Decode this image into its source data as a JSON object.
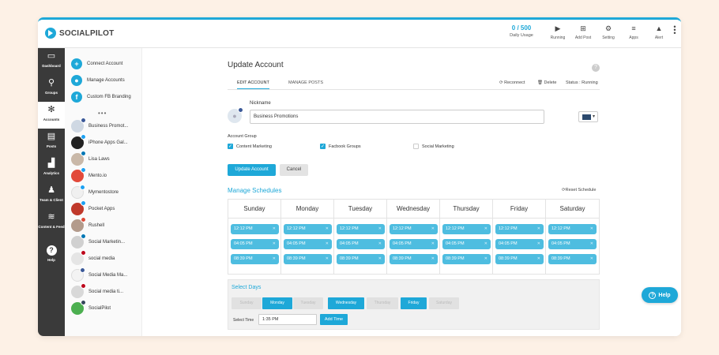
{
  "brand": {
    "name": "SOCIALPILOT",
    "accent": "#1ea8d8"
  },
  "topnav": {
    "usage_value": "0 / 500",
    "usage_label": "Daily Usage",
    "items": [
      {
        "label": "Running",
        "icon": "play-circle-icon"
      },
      {
        "label": "Add Post",
        "icon": "plus-square-icon"
      },
      {
        "label": "Setting",
        "icon": "gear-icon"
      },
      {
        "label": "Apps",
        "icon": "menu-icon"
      },
      {
        "label": "Alert",
        "icon": "bell-icon"
      }
    ]
  },
  "leftnav": [
    {
      "label": "Dashboard",
      "icon": "monitor-icon"
    },
    {
      "label": "Groups",
      "icon": "hierarchy-icon"
    },
    {
      "label": "Accounts",
      "icon": "network-icon"
    },
    {
      "label": "Posts",
      "icon": "chat-icon"
    },
    {
      "label": "Analytics",
      "icon": "bar-chart-icon"
    },
    {
      "label": "Team & Client",
      "icon": "people-icon"
    },
    {
      "label": "Content & Feed",
      "icon": "layers-icon"
    },
    {
      "label": "Help",
      "icon": "question-icon"
    }
  ],
  "account_panel": {
    "actions": [
      {
        "label": "Connect Account",
        "icon": "plus-icon"
      },
      {
        "label": "Manage Accounts",
        "icon": "user-icon"
      },
      {
        "label": "Custom FB Branding",
        "icon": "facebook-icon"
      }
    ],
    "more": "•••",
    "accounts": [
      {
        "name": "Business Promot...",
        "network": "facebook"
      },
      {
        "name": "iPhone Apps Gal...",
        "network": "twitter"
      },
      {
        "name": "Lisa Laws",
        "network": "linkedin"
      },
      {
        "name": "Mento.io",
        "network": "twitter"
      },
      {
        "name": "Mymentostore",
        "network": "twitter"
      },
      {
        "name": "Pocket Apps",
        "network": "twitter"
      },
      {
        "name": "Rushell",
        "network": "google"
      },
      {
        "name": "Social Marketin...",
        "network": "linkedin"
      },
      {
        "name": "social media",
        "network": "pinterest"
      },
      {
        "name": "Social Media Ma...",
        "network": "facebook"
      },
      {
        "name": "Social media ti...",
        "network": "pinterest"
      },
      {
        "name": "SocialPilot",
        "network": "tumblr"
      }
    ]
  },
  "update_account": {
    "title": "Update Account",
    "tabs": [
      "EDIT ACCOUNT",
      "MANAGE POSTS"
    ],
    "tab_actions": {
      "reconnect": "Reconnect",
      "delete": "Delete",
      "status": "Status : Running"
    },
    "nickname_label": "Nickname",
    "nickname_value": "Business Promotions",
    "account_group_label": "Account Group",
    "groups": [
      {
        "label": "Content Marketing",
        "checked": true
      },
      {
        "label": "Facbook Groups",
        "checked": true
      },
      {
        "label": "Social Marketing",
        "checked": false
      }
    ],
    "update_btn": "Update Account",
    "cancel_btn": "Cancel"
  },
  "schedules": {
    "title": "Manage Schedules",
    "reset": "Reset Schedule",
    "days": [
      "Sunday",
      "Monday",
      "Tuesday",
      "Wednesday",
      "Thursday",
      "Friday",
      "Saturday"
    ],
    "times": [
      "12:12 PM",
      "04:05 PM",
      "08:39 PM"
    ]
  },
  "select_days": {
    "title": "Select Days",
    "days": [
      {
        "label": "Sunday",
        "on": false
      },
      {
        "label": "Monday",
        "on": true
      },
      {
        "label": "Tuesday",
        "on": false
      },
      {
        "label": "Wednesday",
        "on": true
      },
      {
        "label": "Thursday",
        "on": false
      },
      {
        "label": "Friday",
        "on": true
      },
      {
        "label": "Saturday",
        "on": false
      }
    ],
    "time_label": "Select Time",
    "time_value": "1:35 PM",
    "add_time": "Add Time"
  },
  "help_fab": "Help"
}
